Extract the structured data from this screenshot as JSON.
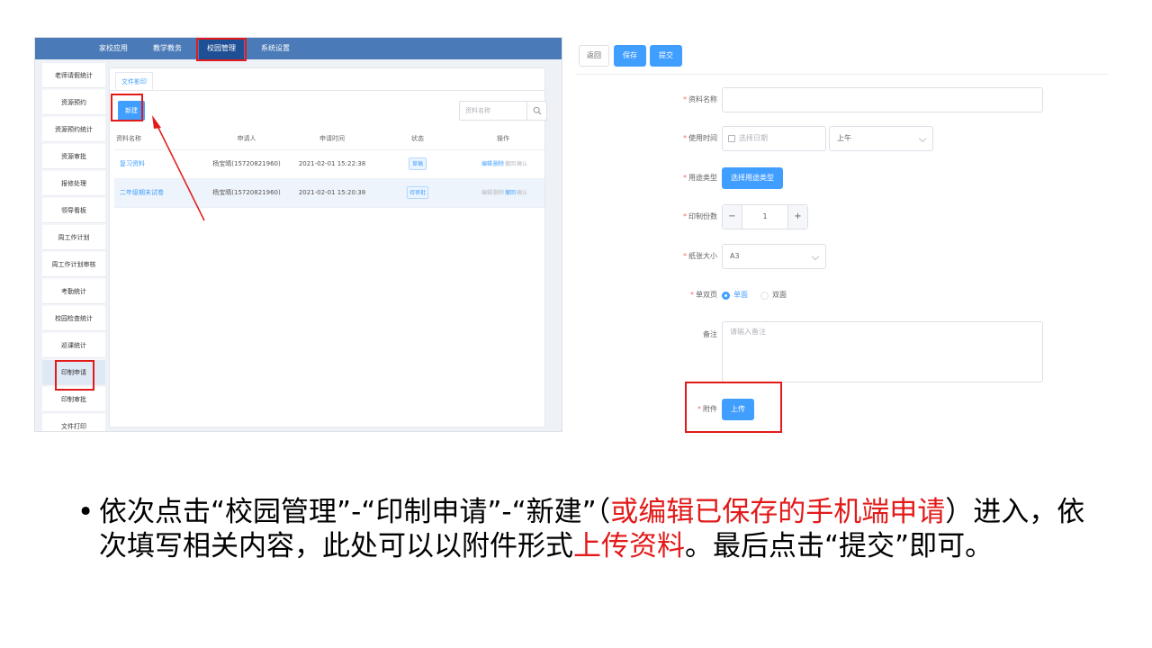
{
  "top_nav": {
    "items": [
      "家校应用",
      "教学教务",
      "校园管理",
      "系统设置"
    ],
    "active": "校园管理"
  },
  "sidebar": {
    "items": [
      "老师请假统计",
      "资源预约",
      "资源预约统计",
      "资源审批",
      "报修处理",
      "领导看板",
      "周工作计划",
      "周工作计划审核",
      "考勤统计",
      "校园检查统计",
      "巡课统计",
      "印制申请",
      "印制审批",
      "文件打印"
    ],
    "active": "印制申请"
  },
  "content": {
    "tab": "文件影印",
    "new_button": "新建",
    "search_placeholder": "资料名称",
    "columns": [
      "资料名称",
      "申请人",
      "申请时间",
      "状态",
      "操作"
    ],
    "rows": [
      {
        "name": "复习资料",
        "applicant": "杨宝晴(15720821960)",
        "time": "2021-02-01 15:22:38",
        "status": "草稿",
        "actions": [
          "编辑",
          "删除",
          "撤回",
          "确认"
        ]
      },
      {
        "name": "二年级期末试卷",
        "applicant": "杨宝晴(15720821960)",
        "time": "2021-02-01 15:20:38",
        "status": "待审批",
        "actions": [
          "编辑",
          "删除",
          "撤回",
          "确认"
        ]
      }
    ]
  },
  "form": {
    "buttons": {
      "back": "返回",
      "save": "保存",
      "submit": "提交"
    },
    "fields": {
      "material_name": {
        "label": "资料名称",
        "value": ""
      },
      "use_time": {
        "label": "使用时间",
        "date_placeholder": "选择日期",
        "period": "上午"
      },
      "purpose": {
        "label": "用途类型",
        "button": "选择用途类型"
      },
      "copies": {
        "label": "印制份数",
        "value": "1",
        "minus": "−",
        "plus": "+"
      },
      "paper": {
        "label": "纸张大小",
        "value": "A3"
      },
      "sides": {
        "label": "单双页",
        "options": [
          "单面",
          "双面"
        ],
        "selected": "单面"
      },
      "remark": {
        "label": "备注",
        "placeholder": "请输入备注"
      },
      "attachment": {
        "label": "附件",
        "button": "上传"
      }
    }
  },
  "caption": {
    "bullet": "•",
    "p1": "依次点击“校园管理”-“印制申请”-“新建”（",
    "p2": "或编辑已保存的手机端申请",
    "p3": "）进入，依次填写相关内容，此处可以以附件形式",
    "p4": "上传资料",
    "p5": "。最后点击“提交”即可。"
  },
  "colors": {
    "primary": "#409eff",
    "nav": "#4a7ab7",
    "highlight": "#e21a1a"
  }
}
